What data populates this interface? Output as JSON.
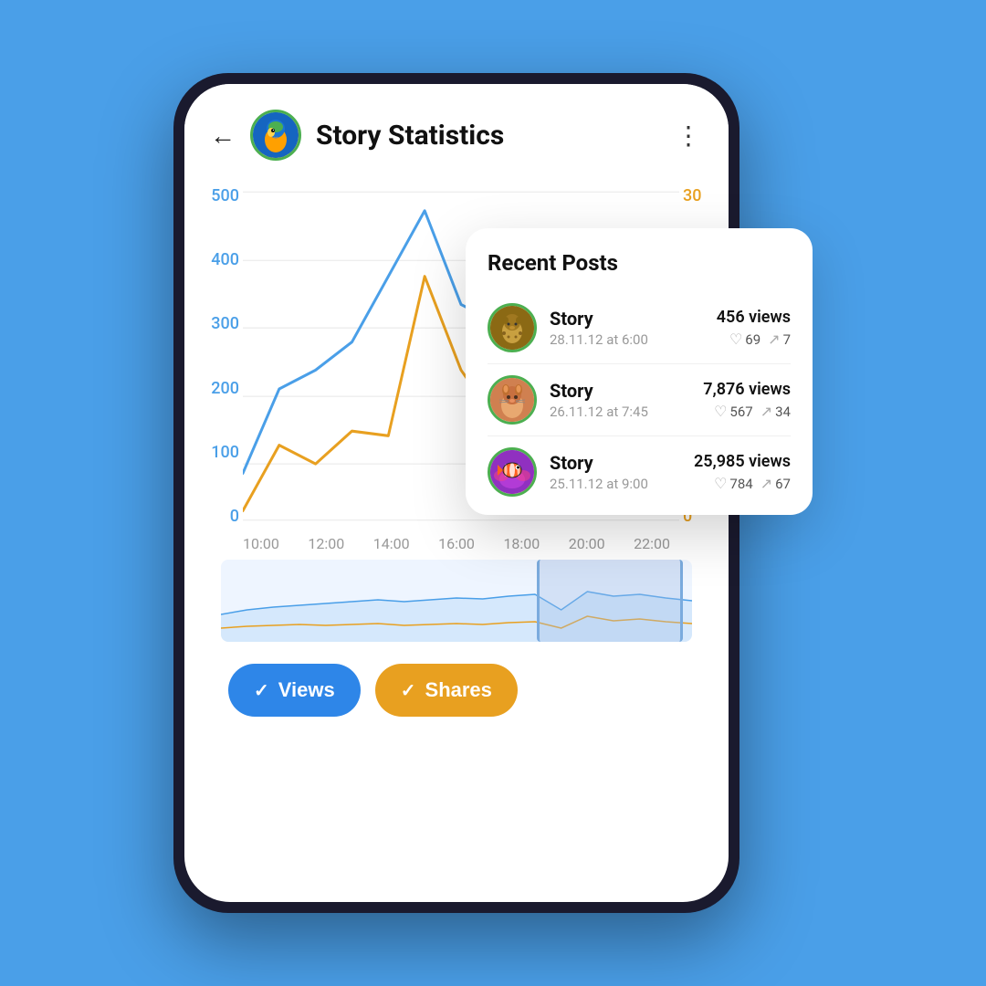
{
  "page": {
    "background_color": "#4A9FE8"
  },
  "header": {
    "back_label": "←",
    "title": "Story Statistics",
    "menu_label": "⋮"
  },
  "chart": {
    "y_labels_left": [
      "500",
      "400",
      "300",
      "200",
      "100",
      "0"
    ],
    "y_labels_right": [
      "30",
      "",
      "",
      "",
      "",
      "0"
    ],
    "x_labels": [
      "10:00",
      "12:00",
      "14:00",
      "16:00",
      "18:00",
      "20:00",
      "22:00"
    ]
  },
  "buttons": {
    "views_label": "Views",
    "shares_label": "Shares",
    "check": "✓"
  },
  "recent_posts": {
    "title": "Recent Posts",
    "posts": [
      {
        "name": "Story",
        "date": "28.11.12 at 6:00",
        "views": "456 views",
        "likes": "69",
        "shares": "7",
        "avatar_emoji": "🐆"
      },
      {
        "name": "Story",
        "date": "26.11.12 at 7:45",
        "views": "7,876 views",
        "likes": "567",
        "shares": "34",
        "avatar_emoji": "🐱"
      },
      {
        "name": "Story",
        "date": "25.11.12 at 9:00",
        "views": "25,985 views",
        "likes": "784",
        "shares": "67",
        "avatar_emoji": "🐠"
      }
    ]
  }
}
